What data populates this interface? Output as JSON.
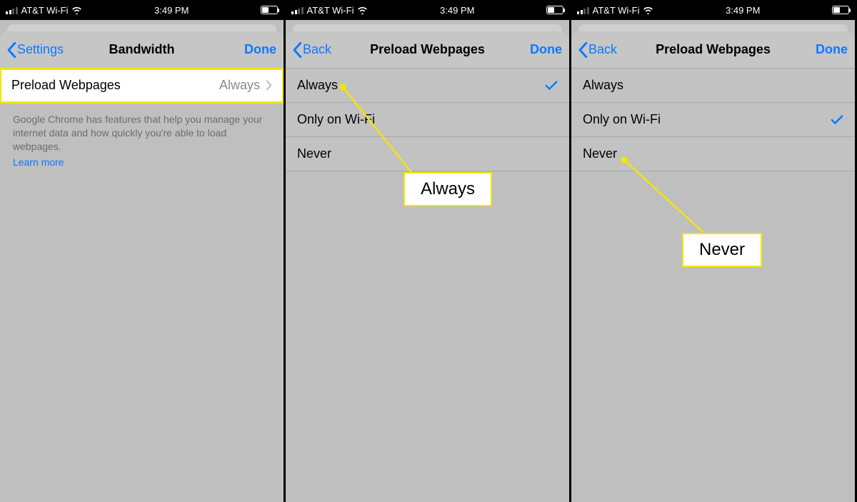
{
  "statusBar": {
    "carrier": "AT&T Wi-Fi",
    "time": "3:49 PM"
  },
  "screen1": {
    "backLabel": "Settings",
    "title": "Bandwidth",
    "doneLabel": "Done",
    "row": {
      "label": "Preload Webpages",
      "value": "Always"
    },
    "footer": "Google Chrome has features that help you manage your internet data and how quickly you're able to load webpages.",
    "learnMore": "Learn more"
  },
  "screen2": {
    "backLabel": "Back",
    "title": "Preload Webpages",
    "doneLabel": "Done",
    "options": [
      "Always",
      "Only on Wi-Fi",
      "Never"
    ],
    "selectedIndex": 0,
    "callout": "Always"
  },
  "screen3": {
    "backLabel": "Back",
    "title": "Preload Webpages",
    "doneLabel": "Done",
    "options": [
      "Always",
      "Only on Wi-Fi",
      "Never"
    ],
    "selectedIndex": 1,
    "callout": "Never"
  }
}
